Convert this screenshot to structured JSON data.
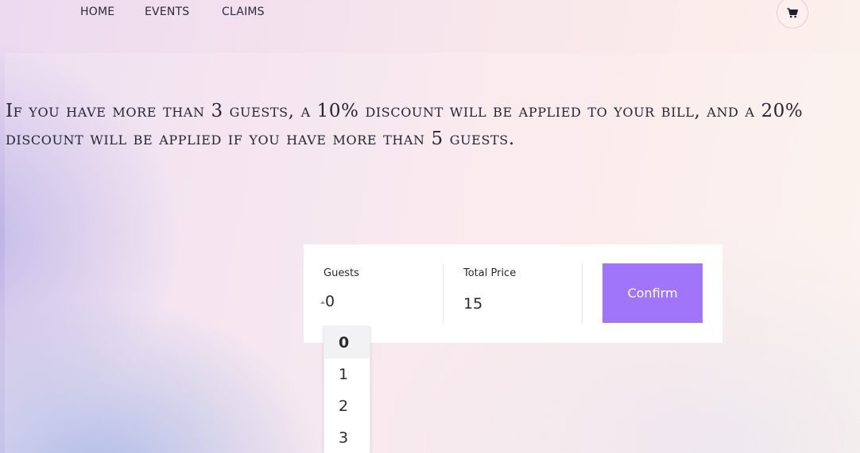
{
  "nav": {
    "links": [
      {
        "label": "HOME"
      },
      {
        "label": "EVENTS"
      },
      {
        "label": "CLAIMS"
      }
    ],
    "cart_icon": "shopping-cart-icon"
  },
  "notice": {
    "text": "If you have more than 3 guests, a 10% discount will be applied to your bill, and a 20% discount will be applied if you have more than 5 guests."
  },
  "booking": {
    "guests_label": "Guests",
    "guests_value": "0",
    "total_label": "Total Price",
    "total_value": "15",
    "confirm_label": "Confirm"
  },
  "guest_dropdown": {
    "options": [
      "0",
      "1",
      "2",
      "3"
    ],
    "selected": "0"
  },
  "colors": {
    "accent": "#a175f9",
    "text": "#262633"
  }
}
